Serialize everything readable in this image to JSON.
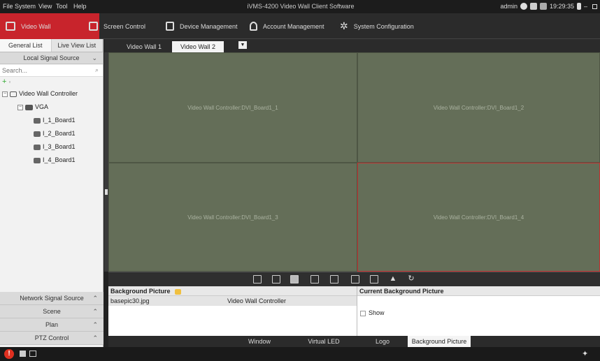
{
  "menu": {
    "items": [
      "File",
      "System",
      "View",
      "Tool",
      "Help"
    ],
    "app_title": "iVMS-4200 Video Wall Client Software",
    "user": "admin",
    "time": "19:29:35"
  },
  "toolbar": {
    "items": [
      {
        "label": "Video Wall",
        "icon": "video-wall-icon"
      },
      {
        "label": "Screen Control",
        "icon": "screen-control-icon"
      },
      {
        "label": "Device Management",
        "icon": "device-management-icon"
      },
      {
        "label": "Account Management",
        "icon": "account-icon"
      },
      {
        "label": "System Configuration",
        "icon": "gear-icon"
      }
    ]
  },
  "left": {
    "tabs": [
      "General List",
      "Live View List"
    ],
    "local_signal": "Local Signal Source",
    "search_placeholder": "Search...",
    "tree": {
      "controller": "Video Wall Controller",
      "group": "VGA",
      "boards": [
        "I_1_Board1",
        "I_2_Board1",
        "I_3_Board1",
        "I_4_Board1"
      ]
    },
    "bottom_sections": [
      "Network Signal Source",
      "Scene",
      "Plan",
      "PTZ Control"
    ]
  },
  "wall": {
    "tabs": [
      "Video Wall 1",
      "Video Wall 2"
    ],
    "cells": [
      "Video Wall Controller:DVI_Board1_1",
      "Video Wall Controller:DVI_Board1_2",
      "Video Wall Controller:DVI_Board1_3",
      "Video Wall Controller:DVI_Board1_4"
    ]
  },
  "bg_panel": {
    "title": "Background Picture",
    "file": "basepic30.jpg",
    "device": "Video Wall Controller"
  },
  "cur_panel": {
    "title": "Current Background Picture",
    "show_label": "Show"
  },
  "bottom_tabs": [
    "Window",
    "Virtual LED",
    "Logo",
    "Background Picture"
  ],
  "colors": {
    "accent": "#c8242c",
    "wall": "#646e58",
    "selected_border": "#c43030"
  }
}
